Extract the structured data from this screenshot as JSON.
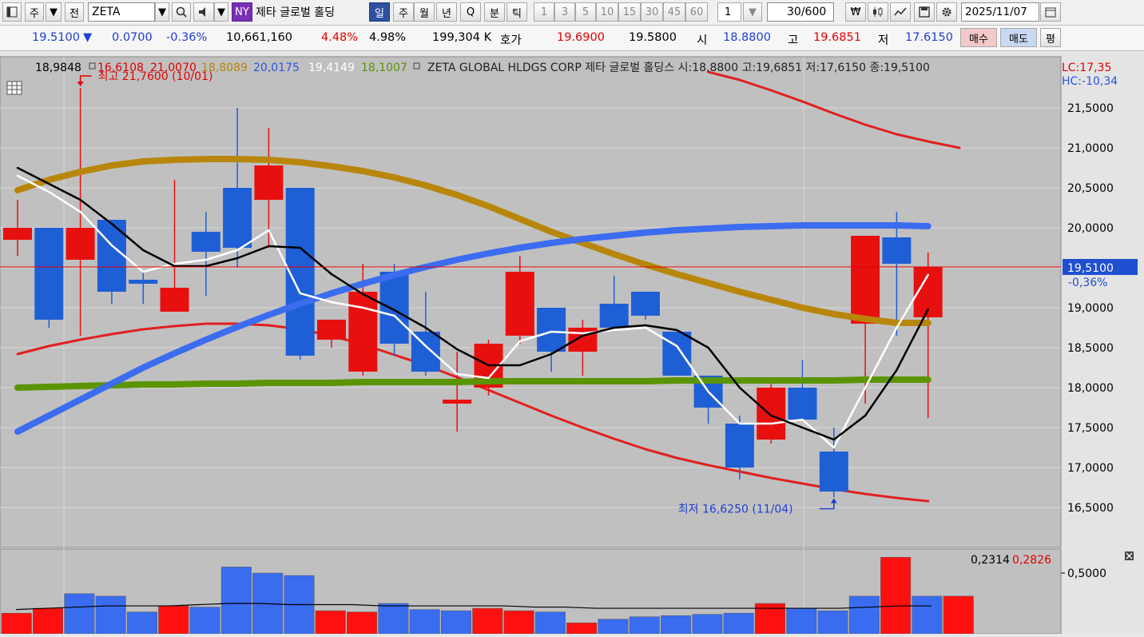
{
  "toolbar": {
    "market": "주",
    "prev": "전",
    "symbol": "ZETA",
    "exchange_badge": "NY",
    "stock_name": "제타 글로벌 홀딩",
    "periods": [
      "일",
      "주",
      "월",
      "년",
      "Q",
      "분",
      "틱"
    ],
    "minutes": [
      "1",
      "3",
      "5",
      "10",
      "15",
      "30",
      "45",
      "60"
    ],
    "interval_value": "1",
    "count": "30",
    "count_total": "/600",
    "date": "2025/11/07",
    "icons": [
      "chart-window-icon",
      "search-icon",
      "speaker-icon",
      "won-icon",
      "candle-icon",
      "line-icon",
      "save-icon",
      "gear-icon",
      "calendar-icon"
    ]
  },
  "quote": {
    "price": "19.5100",
    "arrow": "▼",
    "change": "0.0700",
    "change_pct": "-0.36%",
    "volume": "10,661,160",
    "turnover_pct": "4.48%",
    "pct2": "4.98%",
    "amount": "199,304 K",
    "bid_label": "호가",
    "ask_price": "19.6900",
    "bid_price": "19.5800",
    "open_label": "시",
    "open": "18.8800",
    "high_label": "고",
    "high": "19.6851",
    "low_label": "저",
    "low": "17.6150",
    "buy_label": "매수",
    "sell_label": "매도",
    "eval_label": "평"
  },
  "legend": {
    "v_black": "18,9848",
    "v_red": "16,6108",
    "v_red2": "21,0070",
    "v_gold": "18,8089",
    "v_blue": "20,0175",
    "v_white": "19,4149",
    "v_green": "18,1007",
    "title": "ZETA GLOBAL HLDGS CORP  제타 글로벌 홀딩스 시:18,8800 고:19,6851 저:17,6150 종:19,5100"
  },
  "annotations": {
    "lc": "LC:17,35",
    "hc": "HC:-10,34",
    "high_note": "최고 21,7600 (10/01)",
    "low_note": "최저 16,6250 (11/04)",
    "price_tag": "19,5100",
    "price_tag_pct": "-0,36%",
    "vol_values_black": "0,2314",
    "vol_values_red": "0,2826"
  },
  "colors": {
    "up": "#e8100f",
    "down": "#1f5fd6",
    "gold": "#b8860b",
    "blue_ma": "#3c6cf0",
    "green_ma": "#5a9400",
    "red_band": "#e02020",
    "background": "#c0c0c0"
  },
  "chart_data": {
    "type": "candlestick",
    "ylim": [
      16.25,
      21.85
    ],
    "y_ticks": [
      "21,5000",
      "21,0000",
      "20,5000",
      "20,0000",
      "19,5000",
      "19,0000",
      "18,5000",
      "18,0000",
      "17,5000",
      "17,0000",
      "16,5000"
    ],
    "candles": [
      {
        "o": 19.85,
        "h": 20.35,
        "l": 19.65,
        "c": 20.0
      },
      {
        "o": 20.0,
        "h": 20.0,
        "l": 18.75,
        "c": 18.85
      },
      {
        "o": 19.6,
        "h": 21.75,
        "l": 18.65,
        "c": 20.0
      },
      {
        "o": 20.1,
        "h": 20.1,
        "l": 19.05,
        "c": 19.2
      },
      {
        "o": 19.35,
        "h": 19.45,
        "l": 19.05,
        "c": 19.3
      },
      {
        "o": 18.95,
        "h": 20.6,
        "l": 19.05,
        "c": 19.25
      },
      {
        "o": 19.95,
        "h": 20.2,
        "l": 19.15,
        "c": 19.7
      },
      {
        "o": 20.5,
        "h": 21.5,
        "l": 19.5,
        "c": 19.75
      },
      {
        "o": 20.35,
        "h": 21.25,
        "l": 19.75,
        "c": 20.78
      },
      {
        "o": 20.5,
        "h": 20.5,
        "l": 18.35,
        "c": 18.4
      },
      {
        "o": 18.6,
        "h": 18.85,
        "l": 18.5,
        "c": 18.85
      },
      {
        "o": 18.2,
        "h": 19.55,
        "l": 18.15,
        "c": 19.2
      },
      {
        "o": 19.45,
        "h": 19.55,
        "l": 18.4,
        "c": 18.55
      },
      {
        "o": 18.7,
        "h": 19.2,
        "l": 18.15,
        "c": 18.2
      },
      {
        "o": 17.8,
        "h": 18.45,
        "l": 17.45,
        "c": 17.85
      },
      {
        "o": 18.0,
        "h": 18.6,
        "l": 17.9,
        "c": 18.55
      },
      {
        "o": 18.65,
        "h": 19.65,
        "l": 18.55,
        "c": 19.45
      },
      {
        "o": 19.0,
        "h": 19.0,
        "l": 18.2,
        "c": 18.45
      },
      {
        "o": 18.45,
        "h": 18.85,
        "l": 18.15,
        "c": 18.75
      },
      {
        "o": 19.05,
        "h": 19.4,
        "l": 18.75,
        "c": 18.75
      },
      {
        "o": 19.2,
        "h": 19.2,
        "l": 18.85,
        "c": 18.9
      },
      {
        "o": 18.7,
        "h": 18.7,
        "l": 18.15,
        "c": 18.15
      },
      {
        "o": 18.15,
        "h": 18.15,
        "l": 17.55,
        "c": 17.75
      },
      {
        "o": 17.55,
        "h": 17.65,
        "l": 16.85,
        "c": 17.0
      },
      {
        "o": 17.35,
        "h": 18.05,
        "l": 17.3,
        "c": 18.0
      },
      {
        "o": 18.0,
        "h": 18.35,
        "l": 17.6,
        "c": 17.6
      },
      {
        "o": 17.2,
        "h": 17.5,
        "l": 16.63,
        "c": 16.7
      },
      {
        "o": 18.8,
        "h": 19.9,
        "l": 17.8,
        "c": 19.9
      },
      {
        "o": 19.88,
        "h": 20.2,
        "l": 18.65,
        "c": 19.55
      },
      {
        "o": 18.88,
        "h": 19.69,
        "l": 17.62,
        "c": 19.51
      }
    ],
    "ma_white": [
      20.65,
      20.45,
      20.2,
      19.78,
      19.45,
      19.55,
      19.6,
      19.72,
      19.97,
      19.18,
      19.07,
      19.0,
      18.9,
      18.52,
      18.17,
      18.12,
      18.58,
      18.7,
      18.68,
      18.72,
      18.75,
      18.52,
      17.95,
      17.55,
      17.55,
      17.6,
      17.25,
      18.0,
      18.75,
      19.41
    ],
    "ma_black": [
      20.75,
      20.55,
      20.35,
      20.05,
      19.72,
      19.52,
      19.52,
      19.62,
      19.77,
      19.75,
      19.42,
      19.17,
      18.97,
      18.75,
      18.48,
      18.28,
      18.28,
      18.42,
      18.65,
      18.75,
      18.78,
      18.72,
      18.5,
      18.0,
      17.65,
      17.5,
      17.35,
      17.65,
      18.22,
      18.98
    ],
    "ma_gold": [
      20.47,
      20.6,
      20.7,
      20.78,
      20.83,
      20.85,
      20.86,
      20.86,
      20.85,
      20.82,
      20.77,
      20.71,
      20.63,
      20.53,
      20.41,
      20.27,
      20.11,
      19.95,
      19.81,
      19.67,
      19.54,
      19.42,
      19.31,
      19.2,
      19.1,
      19.0,
      18.92,
      18.86,
      18.81,
      18.81
    ],
    "ma_blue": [
      17.45,
      17.65,
      17.85,
      18.05,
      18.25,
      18.43,
      18.6,
      18.76,
      18.91,
      19.05,
      19.18,
      19.3,
      19.41,
      19.51,
      19.6,
      19.68,
      19.75,
      19.81,
      19.86,
      19.9,
      19.94,
      19.97,
      19.99,
      20.01,
      20.02,
      20.03,
      20.03,
      20.03,
      20.03,
      20.02
    ],
    "ma_green": [
      18.0,
      18.01,
      18.02,
      18.03,
      18.04,
      18.04,
      18.05,
      18.05,
      18.06,
      18.06,
      18.06,
      18.07,
      18.07,
      18.07,
      18.07,
      18.08,
      18.08,
      18.08,
      18.08,
      18.08,
      18.08,
      18.09,
      18.09,
      18.09,
      18.09,
      18.09,
      18.09,
      18.1,
      18.1,
      18.1
    ],
    "band_upper": {
      "start_index": 22,
      "values": [
        21.95,
        21.85,
        21.72,
        21.58,
        21.43,
        21.29,
        21.17,
        21.08,
        21.0
      ]
    },
    "band_lower": [
      18.42,
      18.52,
      18.6,
      18.67,
      18.73,
      18.77,
      18.8,
      18.8,
      18.78,
      18.73,
      18.65,
      18.54,
      18.41,
      18.28,
      18.13,
      17.97,
      17.81,
      17.65,
      17.5,
      17.36,
      17.23,
      17.12,
      17.03,
      16.95,
      16.87,
      16.8,
      16.73,
      16.67,
      16.62,
      16.58
    ],
    "current_price": 19.51,
    "volume": {
      "ylim": [
        0,
        0.62
      ],
      "tick": "0,5000",
      "values": [
        0.17,
        0.21,
        0.33,
        0.31,
        0.18,
        0.23,
        0.22,
        0.55,
        0.5,
        0.48,
        0.19,
        0.18,
        0.25,
        0.2,
        0.19,
        0.21,
        0.19,
        0.18,
        0.09,
        0.12,
        0.14,
        0.15,
        0.16,
        0.17,
        0.25,
        0.21,
        0.19,
        0.31,
        0.63,
        0.31,
        0.31
      ],
      "up": [
        true,
        true,
        false,
        false,
        false,
        true,
        false,
        false,
        false,
        false,
        true,
        true,
        false,
        false,
        false,
        true,
        true,
        false,
        true,
        false,
        false,
        false,
        false,
        false,
        true,
        false,
        false,
        false,
        true,
        false,
        true
      ],
      "ma": [
        0.2,
        0.21,
        0.22,
        0.23,
        0.23,
        0.23,
        0.24,
        0.25,
        0.25,
        0.24,
        0.24,
        0.24,
        0.23,
        0.23,
        0.23,
        0.23,
        0.23,
        0.22,
        0.22,
        0.21,
        0.21,
        0.21,
        0.21,
        0.21,
        0.21,
        0.21,
        0.21,
        0.21,
        0.22,
        0.23,
        0.23
      ]
    }
  }
}
